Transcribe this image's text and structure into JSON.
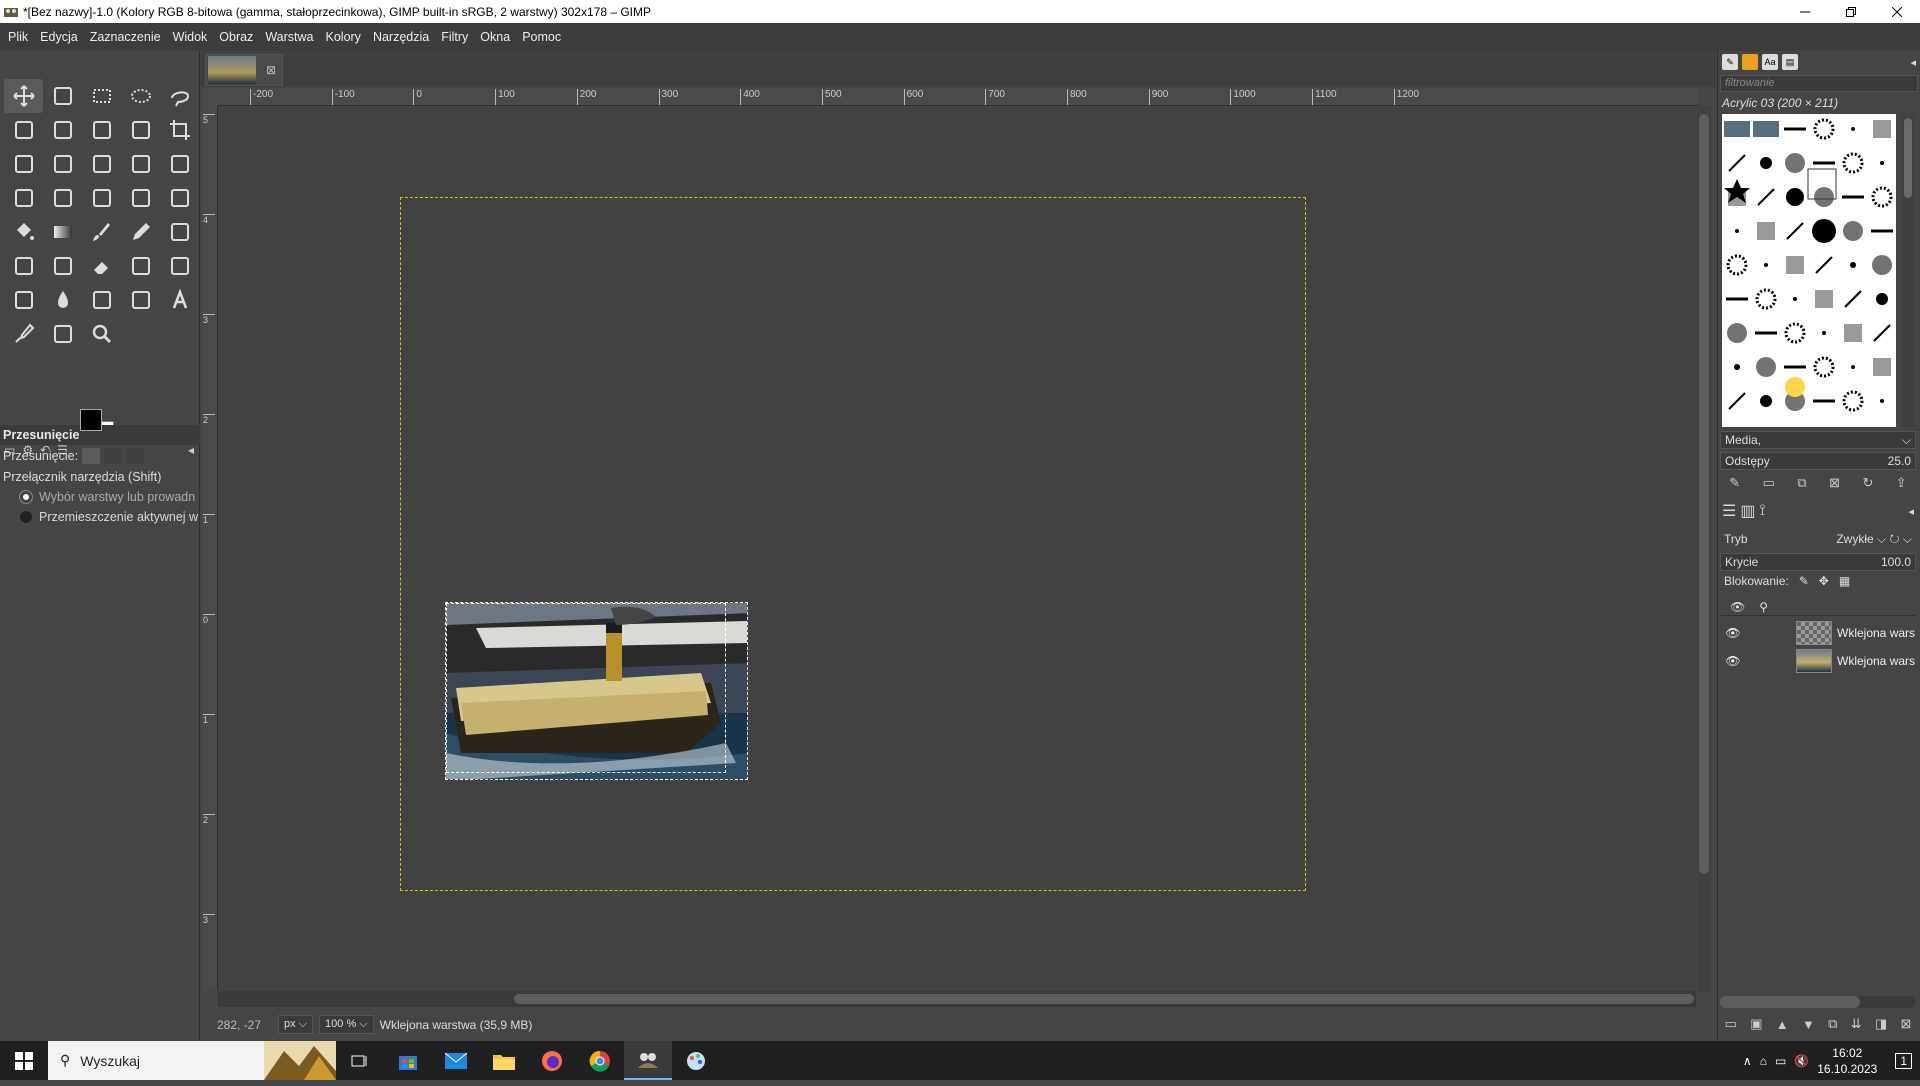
{
  "window": {
    "title": "*[Bez nazwy]-1.0 (Kolory RGB 8-bitowa (gamma, stałoprzecinkowa), GIMP built-in sRGB, 2 warstwy) 302x178 – GIMP"
  },
  "menu": [
    "Plik",
    "Edycja",
    "Zaznaczenie",
    "Widok",
    "Obraz",
    "Warstwa",
    "Kolory",
    "Narzędzia",
    "Filtry",
    "Okna",
    "Pomoc"
  ],
  "tools": [
    "move",
    "align",
    "rect-select",
    "ellipse-select",
    "free-select",
    "scissors",
    "fg-select",
    "fuzzy-select",
    "by-color-select",
    "crop",
    "unified-transform",
    "rotate",
    "scale",
    "shear",
    "flip",
    "perspective",
    "3d-transform",
    "warp",
    "handle-transform",
    "cage",
    "bucket-fill",
    "gradient",
    "paintbrush",
    "pencil",
    "airbrush",
    "ink",
    "mypaint-brush",
    "eraser",
    "clone",
    "heal",
    "smudge",
    "blur",
    "dodge",
    "path",
    "text",
    "color-picker",
    "measure",
    "zoom"
  ],
  "tool_options": {
    "title": "Przesunięcie",
    "move_label": "Przesunięcie:",
    "switch_label": "Przełącznik narzędzia  (Shift)",
    "option1": "Wybór warstwy lub prowadn",
    "option2": "Przemieszczenie aktywnej w"
  },
  "ruler": {
    "top": [
      "-200",
      "-100",
      "0",
      "100",
      "200",
      "300",
      "400",
      "500",
      "600",
      "700",
      "800",
      "900",
      "1000",
      "1100",
      "1200"
    ],
    "left": [
      "5",
      "4",
      "3",
      "2",
      "1",
      "0",
      "1",
      "2",
      "3"
    ]
  },
  "status": {
    "coords": "282, -27",
    "unit": "px",
    "zoom": "100 %",
    "message": "Wklejona warstwa (35,9 MB)"
  },
  "dock": {
    "filter_placeholder": "filtrowanie",
    "brush_name": "Acrylic 03 (200 × 211)",
    "media_label": "Media,",
    "spacing_label": "Odstępy",
    "spacing_value": "25.0",
    "mode_label": "Tryb",
    "mode_value": "Zwykłe",
    "opacity_label": "Krycie",
    "opacity_value": "100.0",
    "lock_label": "Blokowanie:",
    "layers": [
      {
        "name": "Wklejona wars"
      },
      {
        "name": "Wklejona wars"
      }
    ]
  },
  "taskbar": {
    "search_placeholder": "Wyszukaj",
    "time": "16:02",
    "date": "16.10.2023",
    "notif_count": "1"
  }
}
